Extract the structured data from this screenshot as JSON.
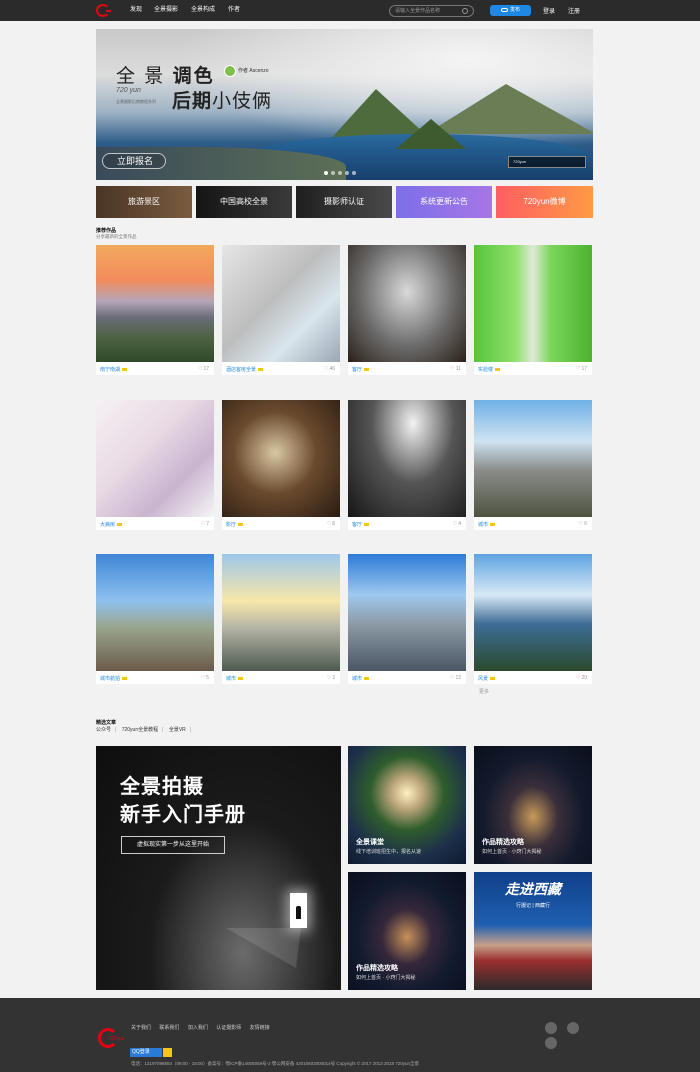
{
  "nav": {
    "items": [
      "发现",
      "全景摄影",
      "全景构成",
      "作者"
    ],
    "search_placeholder": "请输入全景作品名称",
    "publish": "发布",
    "login": "登录",
    "register": "注册"
  },
  "banner": {
    "title_prefix": "全 景",
    "title_bold1": "调色",
    "title_bold2": "后期",
    "title_light": "小伎俩",
    "author": "作者 Ascenzo",
    "brand": "720 yun",
    "brand_sub": "全景摄影后期教程系列",
    "cta": "立即报名",
    "badge": "720yun"
  },
  "categories": [
    "旅游景区",
    "中国高校全景",
    "摄影师认证",
    "系统更新公告",
    "720yun微博"
  ],
  "works_section": {
    "title": "推荐作品",
    "subtitle": "分享最新的全景作品"
  },
  "cards": [
    {
      "label": "南宁南湖",
      "likes": "17"
    },
    {
      "label": "酒店客房全景",
      "likes": "46"
    },
    {
      "label": "客厅",
      "likes": "11"
    },
    {
      "label": "实验楼",
      "likes": "17"
    },
    {
      "label": "大病房",
      "likes": "7"
    },
    {
      "label": "影厅",
      "likes": "8"
    },
    {
      "label": "客厅",
      "likes": "4"
    },
    {
      "label": "城市",
      "likes": "6"
    },
    {
      "label": "城市航拍",
      "likes": "5"
    },
    {
      "label": "城市",
      "likes": "3"
    },
    {
      "label": "城市",
      "likes": "13"
    },
    {
      "label": "风景",
      "likes": "20"
    }
  ],
  "extra_label": "更多",
  "articles": {
    "title": "精选文章",
    "tabs": [
      "公众号",
      "720yun全景教程",
      "全景VR"
    ],
    "feature_title1": "全景拍摄",
    "feature_title2": "新手入门手册",
    "feature_btn": "虚拟现实第一步从这里开始",
    "tiles": [
      {
        "title": "全景课堂",
        "sub": "线下培训班招生中，报名从速"
      },
      {
        "title": "作品精选攻略",
        "sub": "如何上首页 · 小窍门大揭秘"
      },
      {
        "title": "作品精选攻略",
        "sub": "如何上首页 · 小窍门大揭秘"
      },
      {
        "title": "",
        "sub": ""
      }
    ],
    "tibet_title": "走进西藏",
    "tibet_sub": "行摄记 | 西藏行"
  },
  "footer": {
    "logo": "720yun",
    "links": [
      "关于我们",
      "联系我们",
      "加入我们",
      "认证摄影师",
      "友情链接"
    ],
    "qq": "QQ登录",
    "info": "电话：13197098884（09:00 - 18:00）备案号：鄂ICP备14005059号-2  鄂公网安备 42010602000014号        Copyright © 2017 2013 2018 720yun全景"
  },
  "colors": {
    "accent": "#1e88e5",
    "nav_bg": "#2b2b2b",
    "footer_bg": "#333333",
    "brand_red": "#e60012"
  }
}
